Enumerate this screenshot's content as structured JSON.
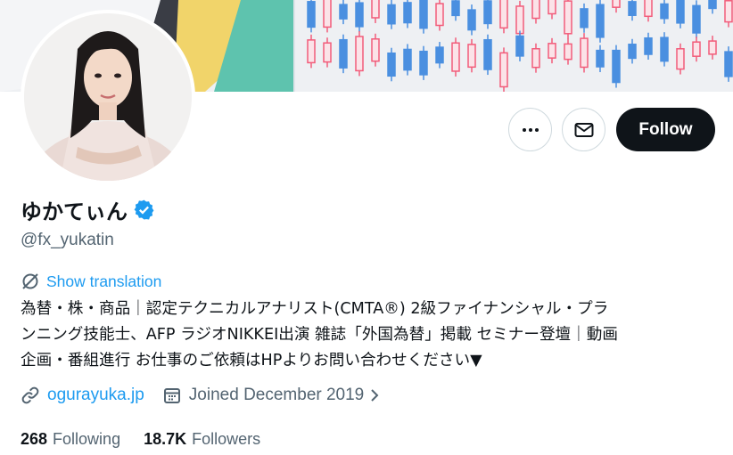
{
  "profile": {
    "display_name": "ゆかてぃん",
    "handle": "@fx_yukatin",
    "verified": true,
    "show_translation": "Show translation",
    "bio": "為替・株・商品｜認定テクニカルアナリスト(CMTA®) 2級ファイナンシャル・プラ\nンニング技能士、AFP ラジオNIKKEI出演 雑誌「外国為替」掲載 セミナー登壇｜動画\n企画・番組進行 お仕事のご依頼はHPよりお問い合わせください▼",
    "website": "ogurayuka.jp",
    "joined": "Joined December 2019"
  },
  "actions": {
    "more_icon": "more-horizontal-icon",
    "message_icon": "envelope-icon",
    "follow_label": "Follow"
  },
  "stats": {
    "following_count": "268",
    "following_label": "Following",
    "followers_count": "18.7K",
    "followers_label": "Followers"
  },
  "colors": {
    "accent": "#1d9bf0",
    "text": "#0f1419",
    "muted": "#536471",
    "follow_bg": "#0f1419",
    "chart_red": "#f25c7a",
    "chart_blue": "#4a8fe0"
  }
}
